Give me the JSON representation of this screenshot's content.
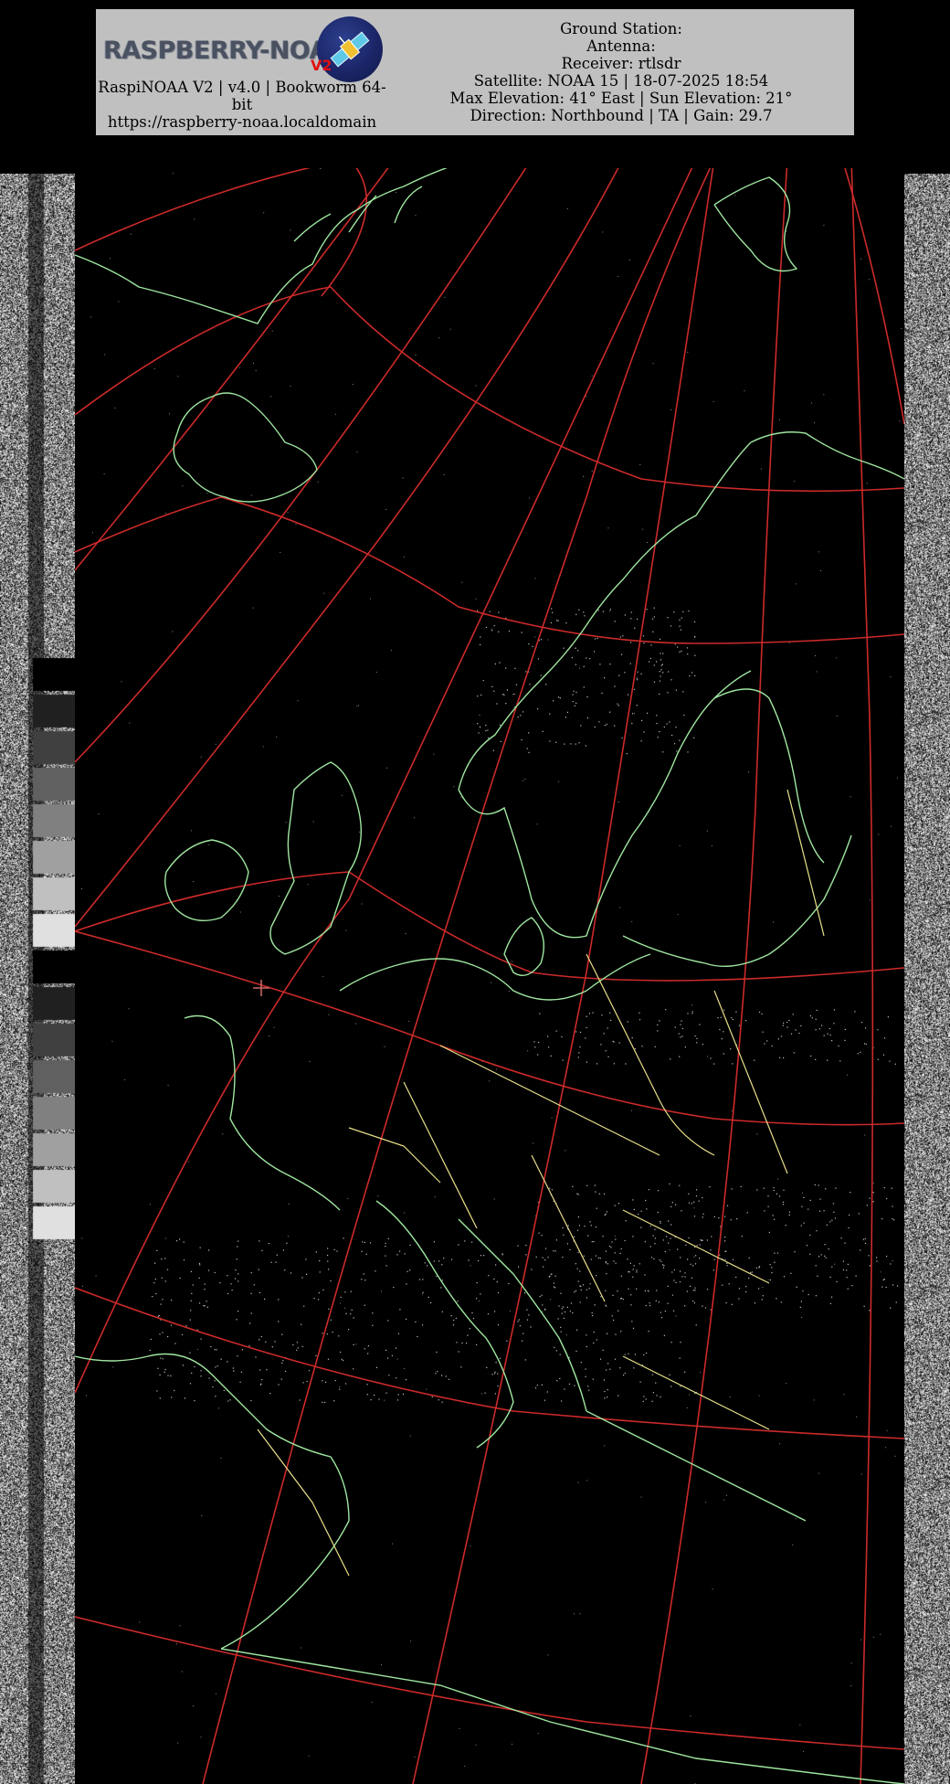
{
  "logo": {
    "text": "RASPBERRY-NOAA",
    "badge": "V2",
    "icon": "satellite-icon"
  },
  "left_info": {
    "version_line": "RaspiNOAA V2 | v4.0 | Bookworm 64-bit",
    "url": "https://raspberry-noaa.localdomain"
  },
  "right_info": {
    "ground_station": "Ground Station:",
    "antenna": "Antenna:",
    "receiver": "Receiver: rtlsdr",
    "satellite": "Satellite: NOAA 15 | 18-07-2025 18:54",
    "elevation": "Max Elevation: 41° East | Sun Elevation: 21°",
    "direction": "Direction: Northbound | TA | Gain: 29.7"
  },
  "colors": {
    "panel_bg": "#c0c0c0",
    "graticule": "#cc2a2a",
    "coastline": "#9fe6a0",
    "borders": "#e8e08a",
    "logo_accent": "#e01010"
  }
}
